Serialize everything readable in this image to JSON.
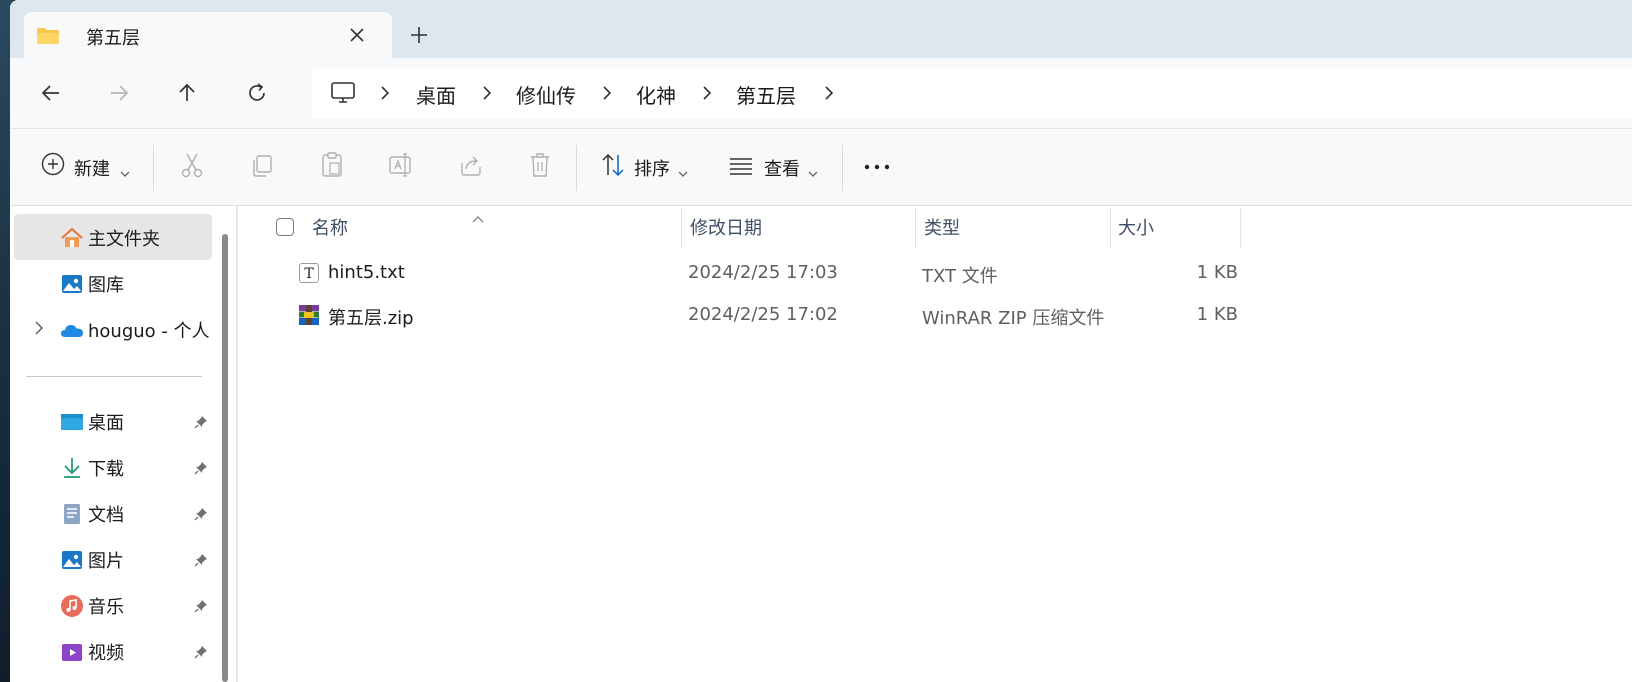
{
  "tab": {
    "title": "第五层"
  },
  "breadcrumbs": [
    "桌面",
    "修仙传",
    "化神",
    "第五层"
  ],
  "toolbar": {
    "new_label": "新建",
    "sort_label": "排序",
    "view_label": "查看"
  },
  "sidebar": {
    "home": "主文件夹",
    "gallery": "图库",
    "onedrive": "houguo - 个人",
    "pinned": [
      {
        "label": "桌面",
        "icon": "desktop-icon"
      },
      {
        "label": "下载",
        "icon": "download-icon"
      },
      {
        "label": "文档",
        "icon": "documents-icon"
      },
      {
        "label": "图片",
        "icon": "pictures-icon"
      },
      {
        "label": "音乐",
        "icon": "music-icon"
      },
      {
        "label": "视频",
        "icon": "videos-icon"
      }
    ]
  },
  "columns": {
    "name": "名称",
    "date": "修改日期",
    "type": "类型",
    "size": "大小"
  },
  "files": [
    {
      "name": "hint5.txt",
      "date": "2024/2/25 17:03",
      "type": "TXT 文件",
      "size": "1 KB",
      "icon": "text-file-icon"
    },
    {
      "name": "第五层.zip",
      "date": "2024/2/25 17:02",
      "type": "WinRAR ZIP 压缩文件",
      "size": "1 KB",
      "icon": "winrar-archive-icon"
    }
  ],
  "colors": {
    "accent": "#0067c0",
    "folder": "#f8c74a",
    "selected": "#e6e6e6"
  }
}
